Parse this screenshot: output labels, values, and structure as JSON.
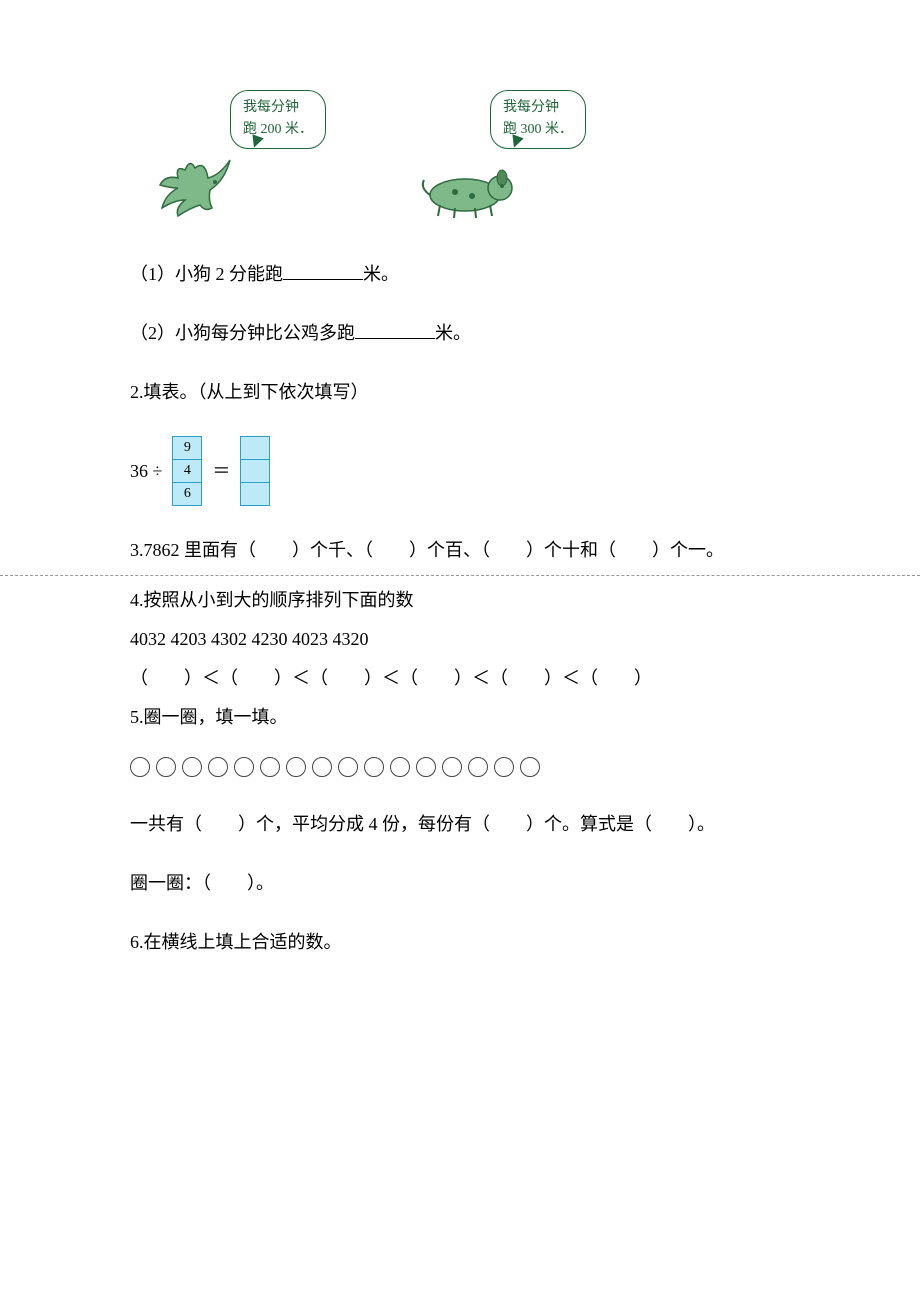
{
  "bubbles": {
    "chicken_line1": "我每分钟",
    "chicken_line2": "跑 200 米．",
    "dog_line1": "我每分钟",
    "dog_line2": "跑 300 米．"
  },
  "q1": {
    "part1_pre": "（1）小狗 2 分能跑",
    "part1_post": "米。",
    "part2_pre": "（2）小狗每分钟比公鸡多跑",
    "part2_post": "米。"
  },
  "q2": {
    "title": "2.填表。（从上到下依次填写）",
    "lhs": "36 ÷",
    "divisors": [
      "9",
      "4",
      "6"
    ],
    "eq": "＝"
  },
  "q3": "3.7862 里面有（　　）个千、（　　）个百、（　　）个十和（　　）个一。",
  "q4": {
    "title": "4.按照从小到大的顺序排列下面的数",
    "numbers": "4032 4203 4302 4230 4023 4320",
    "compare": "（　　）＜（　　）＜（　　）＜（　　）＜（　　）＜（　　）"
  },
  "q5": {
    "title": "5.圈一圈，填一填。",
    "circle_count": 16,
    "line": "一共有（　　）个，平均分成 4 份，每份有（　　）个。算式是（　　）。",
    "circle_label": "圈一圈：（　　）。"
  },
  "q6": "6.在横线上填上合适的数。"
}
